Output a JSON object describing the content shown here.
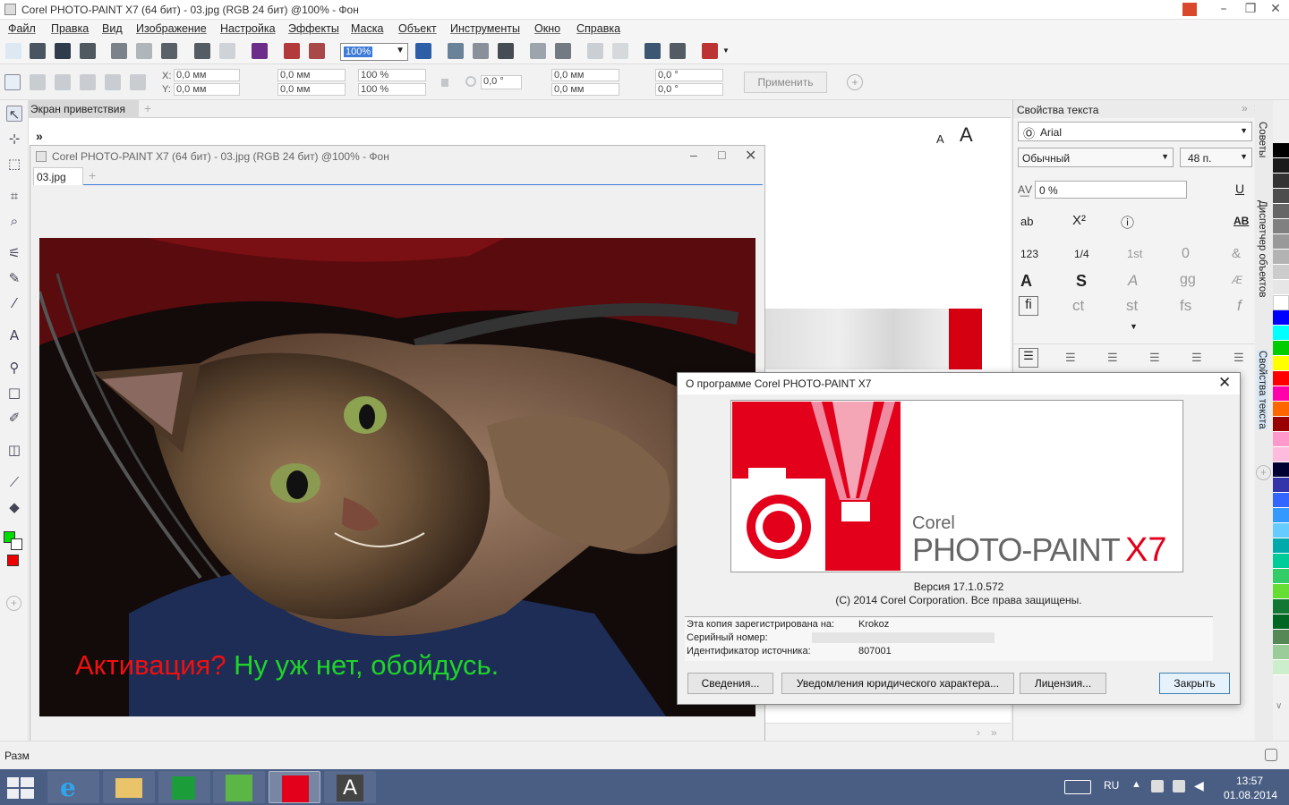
{
  "window": {
    "title": "Corel PHOTO-PAINT X7 (64 бит) - 03.jpg (RGB 24 бит) @100% - Фон"
  },
  "menu": [
    "Файл",
    "Правка",
    "Вид",
    "Изображение",
    "Настройка",
    "Эффекты",
    "Маска",
    "Объект",
    "Инструменты",
    "Окно",
    "Справка"
  ],
  "toolbar": {
    "zoom": "100%"
  },
  "propbar": {
    "x_label": "X:",
    "x": "0,0 мм",
    "y_label": "Y:",
    "y": "0,0 мм",
    "w": "0,0 мм",
    "h": "0,0 мм",
    "sx": "100 %",
    "sy": "100 %",
    "angle": "0,0 °",
    "skx": "0,0 мм",
    "sky": "0,0 мм",
    "r1": "0,0 °",
    "r2": "0,0 °",
    "apply": "Применить"
  },
  "tabs": {
    "welcome": "Экран приветствия",
    "doc": "03.jpg"
  },
  "docwin": {
    "title": "Corel PHOTO-PAINT X7 (64 бит) - 03.jpg (RGB 24 бит) @100% - Фон"
  },
  "photo": {
    "caption_red": "Активация?",
    "caption_green": " Ну уж нет, обойдусь."
  },
  "text_panel": {
    "title": "Свойства текста",
    "font": "Arial",
    "style": "Обычный",
    "size": "48 п.",
    "kerning": "0 %",
    "fraction": "1/4",
    "ordinal": "1st",
    "zero": "0",
    "gg": "gg",
    "ct": "ct",
    "st": "st",
    "fs": "fs",
    "numerals": "123",
    "ab": "ab"
  },
  "dock_tabs": [
    "Советы",
    "Диспетчер объектов",
    "Свойства текста"
  ],
  "about": {
    "title": "О программе Corel PHOTO-PAINT X7",
    "brand_small": "Corel",
    "brand_large": "PHOTO-PAINT",
    "brand_ver": "X7",
    "version": "Версия 17.1.0.572",
    "copyright": "(C) 2014 Corel Corporation.  Все права защищены.",
    "reg_label": "Эта копия зарегистрирована на:",
    "reg_value": "Krokoz",
    "serial_label": "Серийный номер:",
    "source_label": "Идентификатор источника:",
    "source_value": "807001",
    "btn_details": "Сведения...",
    "btn_legal": "Уведомления юридического характера...",
    "btn_license": "Лицензия...",
    "btn_close": "Закрыть"
  },
  "status": {
    "size_label": "Разм"
  },
  "tray": {
    "lang": "RU",
    "time": "13:57",
    "date": "01.08.2014"
  },
  "colors": {
    "accent": "#e2001a",
    "taskbar": "#4a5e84"
  }
}
